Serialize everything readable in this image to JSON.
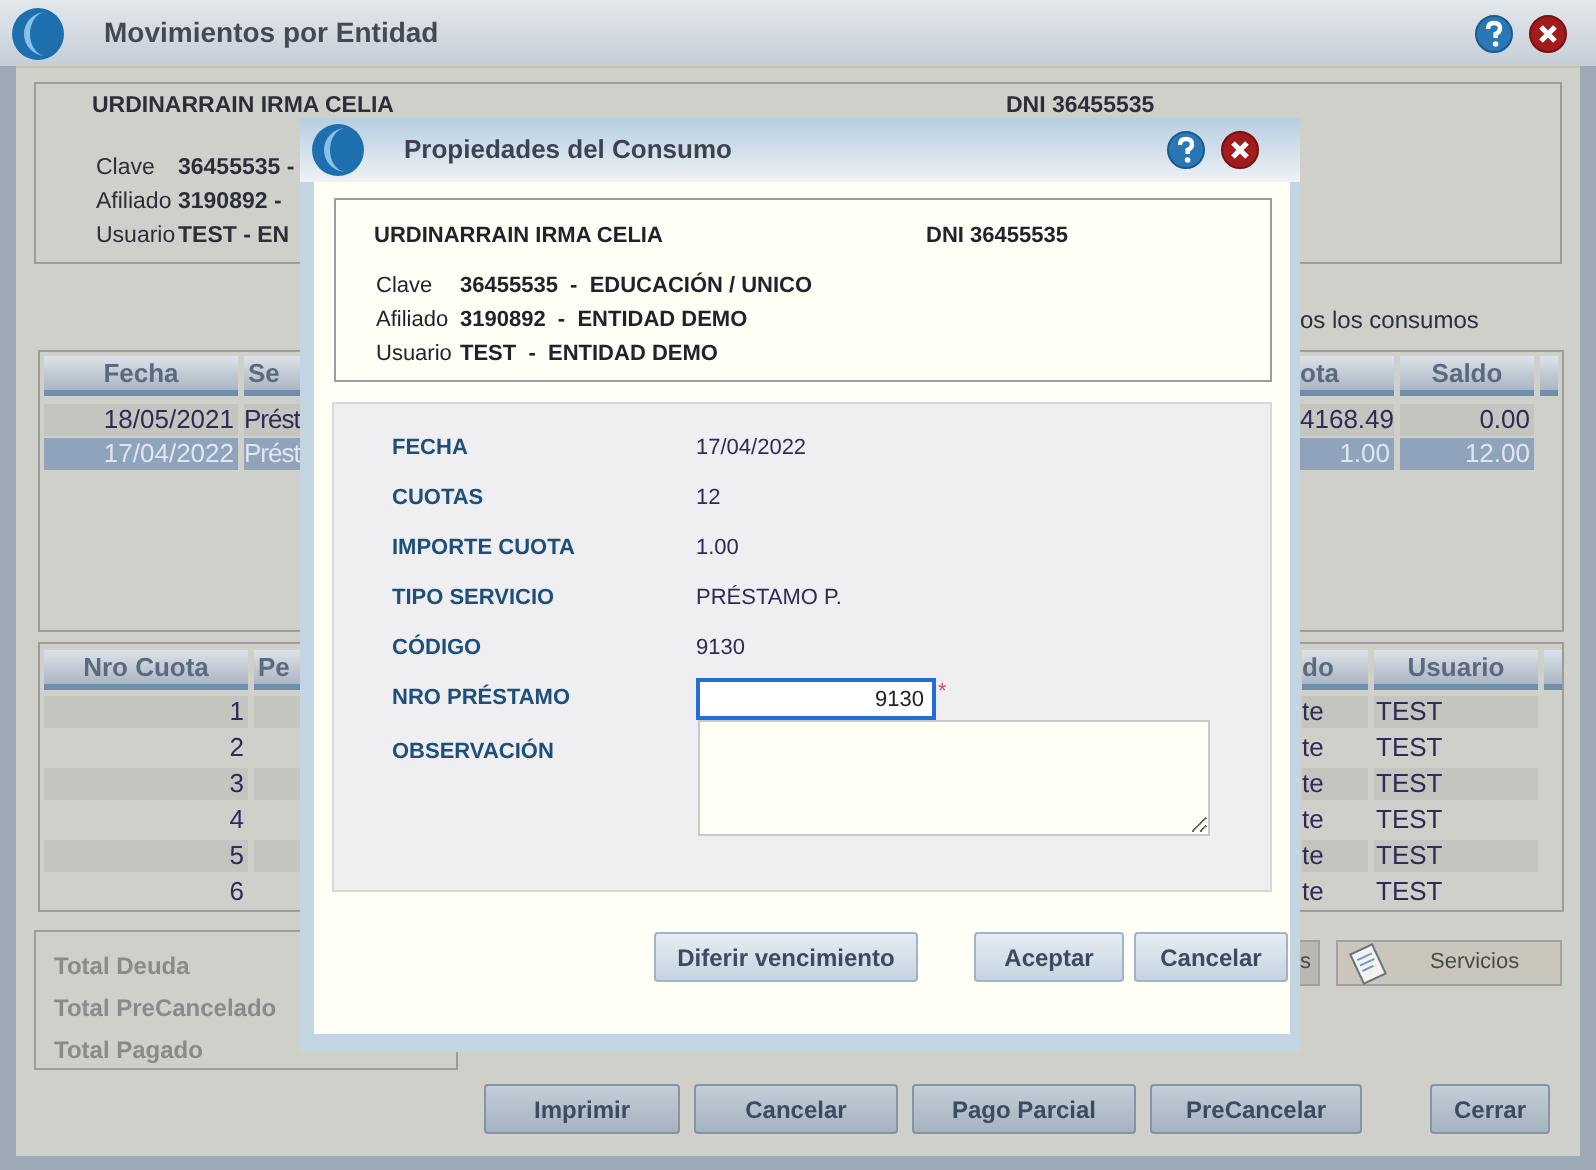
{
  "window": {
    "title": "Movimientos por Entidad"
  },
  "entity": {
    "name": "URDINARRAIN IRMA CELIA",
    "dni": "DNI 36455535",
    "rows": [
      {
        "label": "Clave",
        "value": "36455535 -"
      },
      {
        "label": "Afiliado",
        "value": "3190892 -"
      },
      {
        "label": "Usuario",
        "value": "TEST - EN"
      }
    ]
  },
  "filter_text": "os los consumos",
  "movements": {
    "columns": [
      "Fecha",
      "Se",
      "ota",
      "Saldo"
    ],
    "rows": [
      {
        "cells": [
          "18/05/2021",
          "Prést",
          "4168.49",
          "0.00"
        ],
        "selected": false
      },
      {
        "cells": [
          "17/04/2022",
          "Prést",
          "1.00",
          "12.00"
        ],
        "selected": true
      }
    ]
  },
  "installments": {
    "columns": [
      "Nro Cuota",
      "Pe",
      "do",
      "Usuario"
    ],
    "rows": [
      {
        "nro": "1",
        "column_3": "te",
        "usuario": "TEST"
      },
      {
        "nro": "2",
        "column_3": "te",
        "usuario": "TEST"
      },
      {
        "nro": "3",
        "column_3": "te",
        "usuario": "TEST"
      },
      {
        "nro": "4",
        "column_3": "te",
        "usuario": "TEST"
      },
      {
        "nro": "5",
        "column_3": "te",
        "usuario": "TEST"
      },
      {
        "nro": "6",
        "column_3": "te",
        "usuario": "TEST"
      }
    ]
  },
  "totals": [
    "Total Deuda",
    "Total PreCancelado",
    "Total Pagado"
  ],
  "side_buttons": [
    {
      "label": "s",
      "kind": "plain"
    },
    {
      "label": "Servicios",
      "kind": "icon"
    }
  ],
  "buttons": [
    "Imprimir",
    "Cancelar",
    "Pago Parcial",
    "PreCancelar",
    "Cerrar"
  ],
  "dialog": {
    "title": "Propiedades del Consumo",
    "header": {
      "name": "URDINARRAIN IRMA CELIA",
      "dni": "DNI 36455535",
      "rows": [
        {
          "label": "Clave",
          "value": "36455535  -  EDUCACIÓN / UNICO"
        },
        {
          "label": "Afiliado",
          "value": "3190892  -  ENTIDAD DEMO"
        },
        {
          "label": "Usuario",
          "value": "TEST  -  ENTIDAD DEMO"
        }
      ]
    },
    "fields": [
      {
        "label": "FECHA",
        "kind": "text",
        "value": "17/04/2022"
      },
      {
        "label": "CUOTAS",
        "kind": "text",
        "value": "12"
      },
      {
        "label": "IMPORTE CUOTA",
        "kind": "text",
        "value": "1.00"
      },
      {
        "label": "TIPO SERVICIO",
        "kind": "text",
        "value": "PRÉSTAMO P."
      },
      {
        "label": "CÓDIGO",
        "kind": "text",
        "value": "9130"
      },
      {
        "label": "NRO PRÉSTAMO",
        "kind": "input",
        "value": "9130",
        "required_mark": "*",
        "focused": true
      },
      {
        "label": "OBSERVACIÓN",
        "kind": "textarea"
      }
    ],
    "buttons": [
      "Diferir vencimiento",
      "Aceptar",
      "Cancelar"
    ]
  }
}
